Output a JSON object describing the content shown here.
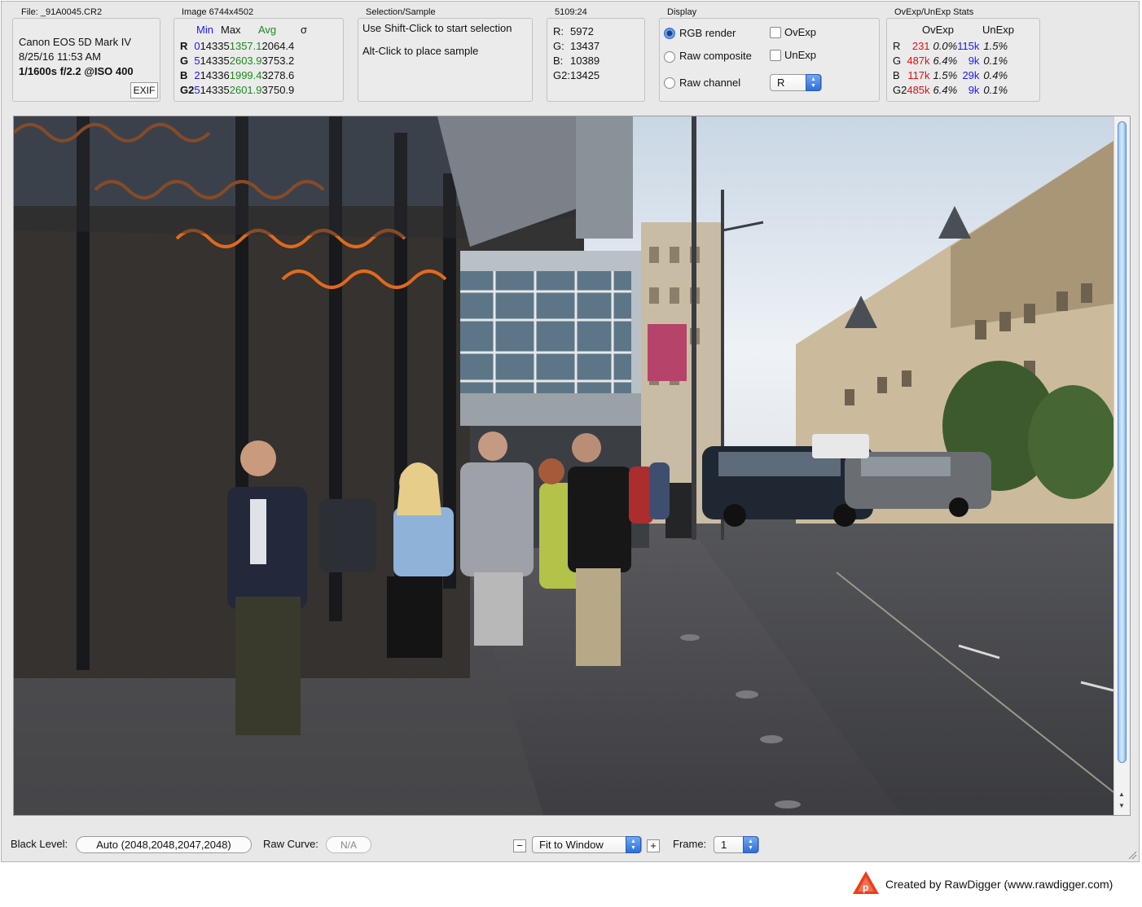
{
  "file_group": {
    "title": "File: _91A0045.CR2",
    "camera": "Canon EOS 5D Mark IV",
    "datetime": "8/25/16 11:53 AM",
    "exposure": "1/1600s f/2.2 @ISO 400",
    "exif_button": "EXIF"
  },
  "image_group": {
    "title": "Image 6744x4502",
    "headers": {
      "min": "Min",
      "max": "Max",
      "avg": "Avg",
      "sigma": "σ"
    },
    "rows": [
      {
        "ch": "R",
        "min": "0",
        "max": "14335",
        "avg": "1357.1",
        "sigma": "2064.4"
      },
      {
        "ch": "G",
        "min": "5",
        "max": "14335",
        "avg": "2603.9",
        "sigma": "3753.2"
      },
      {
        "ch": "B",
        "min": "2",
        "max": "14336",
        "avg": "1999.4",
        "sigma": "3278.6"
      },
      {
        "ch": "G2",
        "min": "5",
        "max": "14335",
        "avg": "2601.9",
        "sigma": "3750.9"
      }
    ]
  },
  "selection_group": {
    "title": "Selection/Sample",
    "line1": "Use Shift-Click to start selection",
    "line2": "Alt-Click to place sample"
  },
  "coords_group": {
    "title": "5109:24",
    "rows": [
      {
        "label": "R:",
        "value": "5972"
      },
      {
        "label": "G:",
        "value": "13437"
      },
      {
        "label": "B:",
        "value": "10389"
      },
      {
        "label": "G2:",
        "value": "13425"
      }
    ]
  },
  "display_group": {
    "title": "Display",
    "rgb_render": "RGB render",
    "raw_composite": "Raw composite",
    "raw_channel": "Raw channel",
    "ovexp": "OvExp",
    "unexp": "UnExp",
    "channel_value": "R",
    "selected_mode": "RGB render"
  },
  "ovexp_group": {
    "title": "OvExp/UnExp Stats",
    "headers": {
      "ovexp": "OvExp",
      "unexp": "UnExp"
    },
    "rows": [
      {
        "ch": "R",
        "ov_count": "231",
        "ov_pct": "0.0%",
        "un_count": "115k",
        "un_pct": "1.5%"
      },
      {
        "ch": "G",
        "ov_count": "487k",
        "ov_pct": "6.4%",
        "un_count": "9k",
        "un_pct": "0.1%"
      },
      {
        "ch": "B",
        "ov_count": "117k",
        "ov_pct": "1.5%",
        "un_count": "29k",
        "un_pct": "0.4%"
      },
      {
        "ch": "G2",
        "ov_count": "485k",
        "ov_pct": "6.4%",
        "un_count": "9k",
        "un_pct": "0.1%"
      }
    ]
  },
  "bottom_bar": {
    "black_level_label": "Black Level:",
    "black_level_value": "Auto (2048,2048,2047,2048)",
    "raw_curve_label": "Raw Curve:",
    "raw_curve_value": "N/A",
    "zoom_minus": "−",
    "zoom_value": "Fit to Window",
    "zoom_plus": "+",
    "frame_label": "Frame:",
    "frame_value": "1"
  },
  "credit": {
    "text": "Created by RawDigger (www.rawdigger.com)",
    "logo_icon": "rawdigger-logo-icon"
  },
  "colors": {
    "accent_blue": "#1a1aff",
    "avg_green": "#1c8a1c",
    "ovexp_red": "#e01010"
  }
}
